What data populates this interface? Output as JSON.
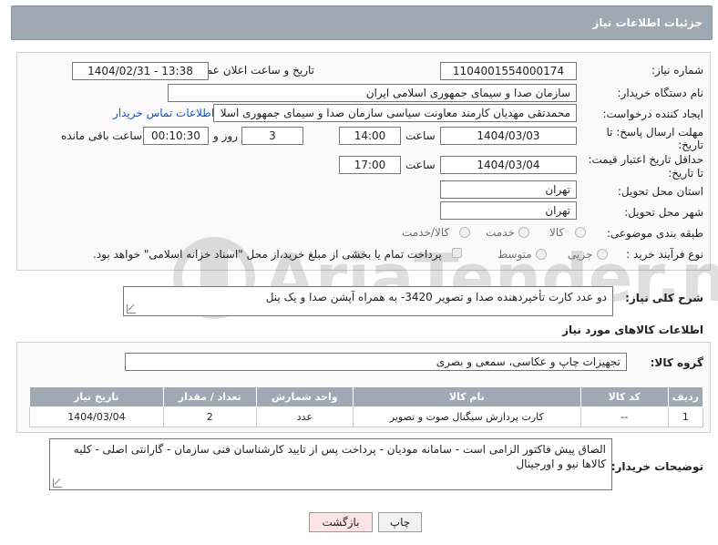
{
  "header": {
    "title": "جزئیات اطلاعات نیاز"
  },
  "form": {
    "need_number": {
      "label": "شماره نیاز:",
      "value": "1104001554000174"
    },
    "announce_datetime": {
      "label": "تاریخ و ساعت اعلان عمومی:",
      "value": "1404/02/31 - 13:38"
    },
    "buyer_org": {
      "label": "نام دستگاه خریدار:",
      "value": "سازمان صدا و سیمای جمهوری اسلامی ایران"
    },
    "requester": {
      "label": "ایجاد کننده درخواست:",
      "value": "محمدتقی مهدیان کارمند معاونت سیاسی سازمان صدا و سیمای جمهوری اسلا",
      "contact_link": "اطلاعات تماس خریدار"
    },
    "reply_deadline": {
      "label_line1": "مهلت ارسال پاسخ: تا",
      "label_line2": "تاریخ:",
      "date": "1404/03/03",
      "time_label": "ساعت",
      "time": "14:00",
      "days": "3",
      "days_label": "روز و",
      "remaining": "00:10:30",
      "remaining_label": "ساعت باقی مانده"
    },
    "price_validity": {
      "label_line1": "حداقل تاریخ اعتبار قیمت:",
      "label_line2": "تا تاریخ:",
      "date": "1404/03/04",
      "time_label": "ساعت",
      "time": "17:00"
    },
    "delivery_province": {
      "label": "استان محل تحویل:",
      "value": "تهران"
    },
    "delivery_city": {
      "label": "شهر محل تحویل:",
      "value": "تهران"
    },
    "category": {
      "label": "طبقه بندی موضوعی:",
      "options": [
        "کالا",
        "خدمت",
        "کالا/خدمت"
      ]
    },
    "process": {
      "label": "نوع فرآیند خرید :",
      "options": [
        "جزیی",
        "متوسط"
      ],
      "payment_note": "پرداخت تمام یا بخشی از مبلغ خرید،از محل \"اسناد خزانه اسلامی\" خواهد بود."
    }
  },
  "description": {
    "label": "شرح کلی نیاز:",
    "value": "دو عدد کارت تأخیردهنده صدا و تصویر 3420- به همراه آپشن صدا و یک پنل"
  },
  "goods": {
    "section_title": "اطلاعات کالاهای مورد نیاز",
    "group_label": "گروه کالا:",
    "group_value": "تجهیزات چاپ و عکاسی، سمعی و بصری",
    "columns": [
      "ردیف",
      "کد کالا",
      "نام کالا",
      "واحد شمارش",
      "تعداد / مقدار",
      "تاریخ نیاز"
    ],
    "rows": [
      [
        "1",
        "--",
        "کارت پردازش سیگنال صوت و تصویر",
        "عدد",
        "2",
        "1404/03/04"
      ]
    ]
  },
  "buyer_notes": {
    "label": "توضیحات خریدار:",
    "value": "الصاق پیش فاکتور الزامی است - سامانه مودیان - پرداخت پس از تایید کارشناسان فنی سازمان - گارانتی اصلی - کلیه کالاها نیو و اورجینال"
  },
  "buttons": {
    "print": "چاپ",
    "back": "بازگشت"
  },
  "watermark": {
    "text": "AriaTender.neT"
  },
  "colors": {
    "header_bg": "#9fa9b3",
    "link": "#1a55c8",
    "back_btn_bg": "#fbe3e6"
  }
}
